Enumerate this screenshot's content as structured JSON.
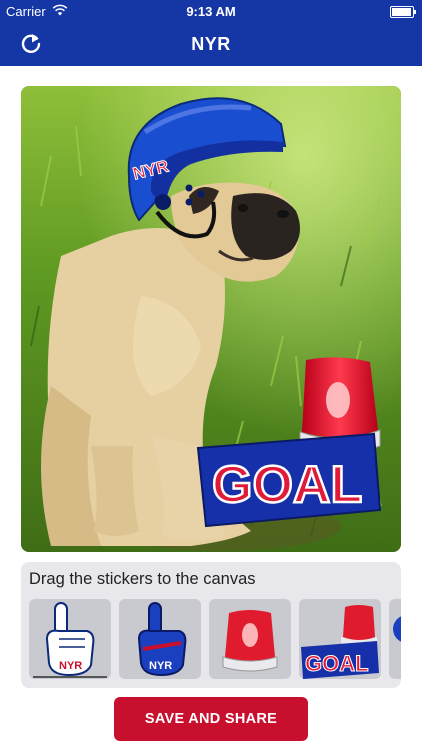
{
  "status_bar": {
    "carrier": "Carrier",
    "time": "9:13 AM",
    "battery_level": 0.95
  },
  "nav": {
    "title": "NYR",
    "refresh_icon": "refresh-icon"
  },
  "canvas": {
    "photo": "pug-on-grass",
    "stickers": [
      {
        "name": "hockey-helmet-sticker",
        "text": "NYR"
      },
      {
        "name": "goal-light-sticker",
        "text": "GOAL"
      }
    ]
  },
  "tray": {
    "label": "Drag the stickers to the canvas",
    "items": [
      {
        "name": "foam-finger-white",
        "text": "NYR"
      },
      {
        "name": "foam-finger-blue",
        "text": "NYR"
      },
      {
        "name": "goal-siren",
        "text": ""
      },
      {
        "name": "goal-siren-banner",
        "text": "GOAL"
      }
    ]
  },
  "save_button": {
    "label": "SAVE AND SHARE"
  },
  "colors": {
    "brand_blue": "#1537a6",
    "brand_red": "#c8102e"
  }
}
